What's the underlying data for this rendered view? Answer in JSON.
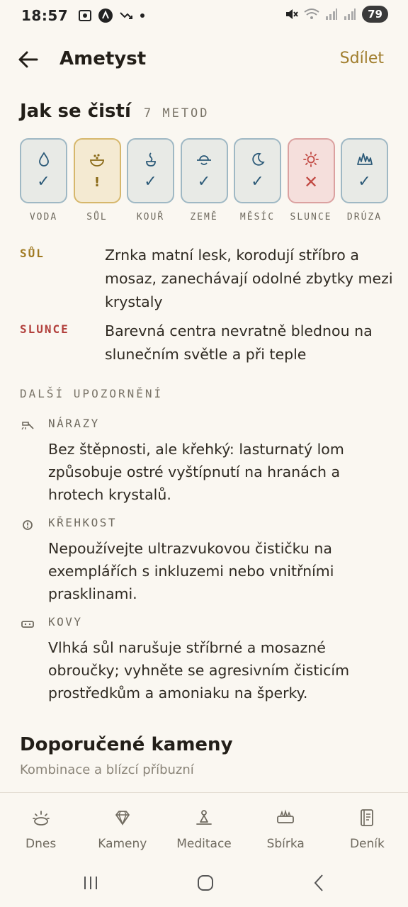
{
  "status_bar": {
    "time": "18:57",
    "battery": "79",
    "icons_left": [
      "screenshot-icon",
      "app-badge-icon",
      "missed-call-icon",
      "dot-icon"
    ],
    "icons_right": [
      "mute-icon",
      "wifi-icon",
      "signal-icon",
      "signal-icon"
    ]
  },
  "header": {
    "back_icon": "arrow-left-icon",
    "title": "Ametyst",
    "share_label": "Sdílet"
  },
  "cleaning": {
    "title": "Jak se čistí",
    "count": "7 METOD",
    "methods": [
      {
        "label": "VODA",
        "icon": "water-drop-icon",
        "status": "safe",
        "status_glyph": "✓"
      },
      {
        "label": "SŮL",
        "icon": "salt-bowl-icon",
        "status": "caution",
        "status_glyph": "!"
      },
      {
        "label": "KOUŘ",
        "icon": "smoke-icon",
        "status": "safe",
        "status_glyph": "✓"
      },
      {
        "label": "ZEMĚ",
        "icon": "earth-icon",
        "status": "safe",
        "status_glyph": "✓"
      },
      {
        "label": "MĚSÍC",
        "icon": "moon-icon",
        "status": "safe",
        "status_glyph": "✓"
      },
      {
        "label": "SLUNCE",
        "icon": "sun-icon",
        "status": "unsafe",
        "status_glyph": "✕"
      },
      {
        "label": "DRÚZA",
        "icon": "druse-icon",
        "status": "safe",
        "status_glyph": "✓"
      }
    ],
    "warnings": [
      {
        "key": "SŮL",
        "text": "Zrnka matní lesk, korodují stříbro a mosaz, zanechávají odolné zbytky mezi krystaly"
      },
      {
        "key": "SLUNCE",
        "text": "Barevná centra nevratně blednou na slunečním světle a při teple"
      }
    ]
  },
  "more_warnings": {
    "title": "DALŠÍ UPOZORNĚNÍ",
    "items": [
      {
        "icon": "hammer-icon",
        "key": "NÁRAZY",
        "text": "Bez štěpnosti, ale křehký: lasturnatý lom způsobuje ostré vyštípnutí na hranách a hrotech krystalů."
      },
      {
        "icon": "alert-circle-icon",
        "key": "KŘEHKOST",
        "text": "Nepoužívejte ultrazvukovou čističku na exemplářích s inkluzemi nebo vnitřními prasklinami."
      },
      {
        "icon": "ring-icon",
        "key": "KOVY",
        "text": "Vlhká sůl narušuje stříbrné a mosazné obroučky; vyhněte se agresivním čisticím prostředkům a amoniaku na šperky."
      }
    ]
  },
  "recommended": {
    "title": "Doporučené kameny",
    "subtitle": "Kombinace a blízcí příbuzní"
  },
  "bottom_nav": [
    {
      "label": "Dnes",
      "icon": "sunrise-icon"
    },
    {
      "label": "Kameny",
      "icon": "gem-icon"
    },
    {
      "label": "Meditace",
      "icon": "meditation-icon"
    },
    {
      "label": "Sbírka",
      "icon": "collection-icon"
    },
    {
      "label": "Deník",
      "icon": "journal-icon"
    }
  ],
  "colors": {
    "background": "#faf7f1",
    "accent": "#a07d2c",
    "safe": "#2c5a78",
    "caution": "#8a6a18",
    "unsafe": "#c24a44"
  }
}
